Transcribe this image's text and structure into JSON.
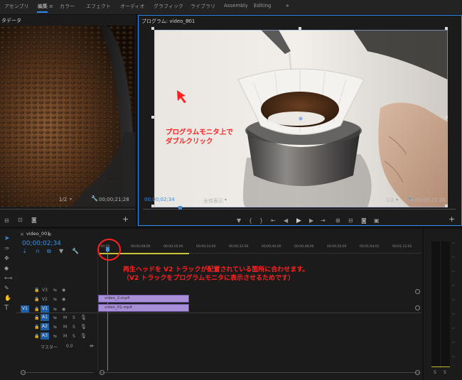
{
  "workspace_tabs": [
    {
      "label": "アセンブリ",
      "active": false
    },
    {
      "label": "編集",
      "active": true
    },
    {
      "label": "カラー",
      "active": false
    },
    {
      "label": "エフェクト",
      "active": false
    },
    {
      "label": "オーディオ",
      "active": false
    },
    {
      "label": "グラフィック",
      "active": false
    },
    {
      "label": "ライブラリ",
      "active": false
    },
    {
      "label": "Assembly",
      "active": false
    },
    {
      "label": "Editing",
      "active": false
    }
  ],
  "workspace_more": "»",
  "source_monitor": {
    "title": "タデータ",
    "zoom": "1/2",
    "timecode": "00;00;21;28"
  },
  "program_monitor": {
    "title": "プログラム: video_001",
    "menu": "≡",
    "timecode_left": "00;00;02;34",
    "fit": "全体表示",
    "zoom": "1/2",
    "timecode_right": "00;00;21;28"
  },
  "timeline": {
    "sequence_tab": "video_001",
    "timecode": "00;00;02;34",
    "ruler": [
      ":00;00",
      "00;00;08;00",
      "00;00;16;00",
      "00;00;24;00",
      "00;00;32;00",
      "00;00;40;00",
      "00;00;48;00",
      "00;00;56;00",
      "00;01;04;02",
      "00;01;12;02"
    ],
    "video_tracks": [
      {
        "name": "V3",
        "source": ""
      },
      {
        "name": "V2",
        "source": ""
      },
      {
        "name": "V1",
        "source": "V1"
      }
    ],
    "audio_tracks": [
      {
        "name": "A1",
        "m": "M",
        "s": "S"
      },
      {
        "name": "A2",
        "m": "M",
        "s": "S"
      },
      {
        "name": "A3",
        "m": "M",
        "s": "S"
      }
    ],
    "master_label": "マスター",
    "master_value": "0.0",
    "clips": [
      {
        "label": "video_2.mp4",
        "track": "V2"
      },
      {
        "label": "video_01.mp4",
        "track": "V1"
      }
    ]
  },
  "meter": {
    "labels": [
      "S",
      "S"
    ]
  },
  "annotations": {
    "program_line1": "プログラムモニタ上で",
    "program_line2": "ダブルクリック",
    "timeline_line1": "再生ヘッドを V2 トラックが配置されている箇所に合わせます。",
    "timeline_line2": "（V2 トラックをプログラムモニタに表示させるためです）"
  },
  "colors": {
    "accent": "#2d8ceb",
    "annotation": "#ff2020",
    "clip": "#a98fd8",
    "track_target": "#1f5fa5"
  }
}
